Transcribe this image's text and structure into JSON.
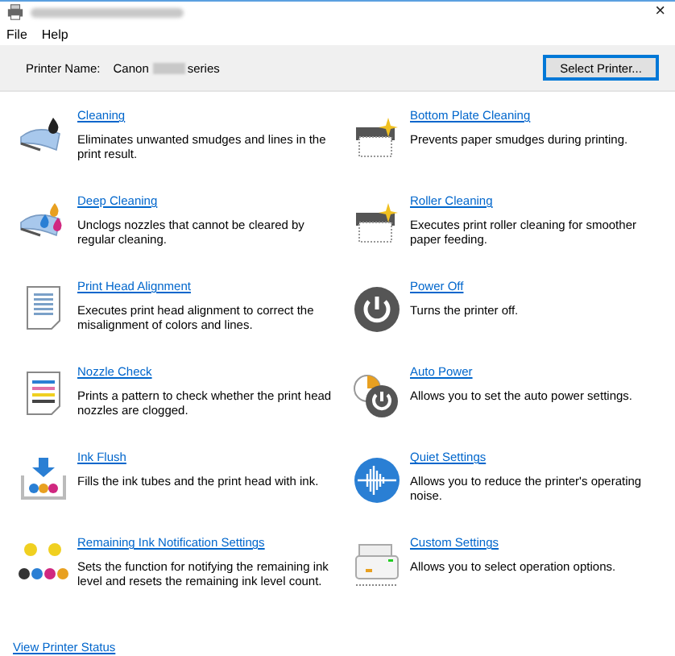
{
  "window": {
    "close": "×"
  },
  "menu": [
    "File",
    "Help"
  ],
  "printer": {
    "label": "Printer Name:",
    "brand": "Canon",
    "suffix": "series",
    "button": "Select Printer..."
  },
  "left": [
    {
      "title": "Cleaning",
      "description": "Eliminates unwanted smudges and lines in the print result."
    },
    {
      "title": "Deep Cleaning",
      "description": "Unclogs nozzles that cannot be cleared by regular cleaning."
    },
    {
      "title": "Print Head Alignment",
      "description": "Executes print head alignment to correct the misalignment of colors and lines."
    },
    {
      "title": "Nozzle Check",
      "description": "Prints a pattern to check whether the print head nozzles are clogged."
    },
    {
      "title": "Ink Flush",
      "description": "Fills the ink tubes and the print head with ink."
    },
    {
      "title": "Remaining Ink Notification Settings",
      "description": "Sets the function for notifying the remaining ink level and resets the remaining ink level count."
    }
  ],
  "right": [
    {
      "title": "Bottom Plate Cleaning",
      "description": "Prevents paper smudges during printing."
    },
    {
      "title": "Roller Cleaning",
      "description": "Executes print roller cleaning for smoother paper feeding."
    },
    {
      "title": "Power Off",
      "description": "Turns the printer off."
    },
    {
      "title": "Auto Power",
      "description": "Allows you to set the auto power settings."
    },
    {
      "title": "Quiet Settings",
      "description": "Allows you to reduce the printer's operating noise."
    },
    {
      "title": "Custom Settings",
      "description": "Allows you to select operation options."
    }
  ],
  "footer_link": "View Printer Status"
}
